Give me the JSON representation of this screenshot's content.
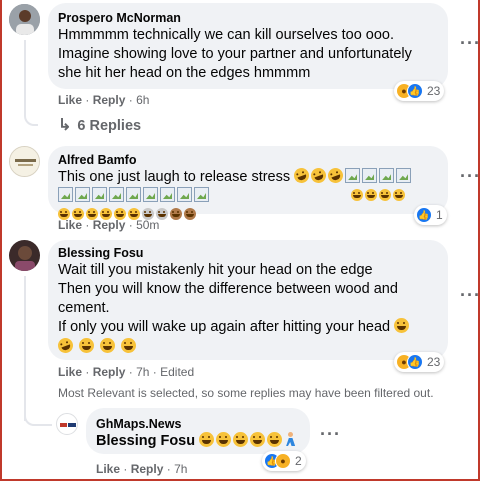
{
  "comments": [
    {
      "author": "Prospero McNorman",
      "lines": [
        "Hmmmmm technically we can kill ourselves too ooo.",
        "Imagine showing love to your partner and unfortunately",
        "she hit her head on the edges hmmmm"
      ],
      "like_label": "Like",
      "reply_label": "Reply",
      "time": "6h",
      "reaction_count": "23",
      "replies_label": "6 Replies"
    },
    {
      "author": "Alfred Bamfo",
      "line1": "This one just laugh to release stress",
      "like_label": "Like",
      "reply_label": "Reply",
      "time": "50m",
      "reaction_count": "1"
    },
    {
      "author": "Blessing Fosu",
      "lines": [
        "Wait till you mistakenly hit your head on the edge",
        "Then you will know the difference between wood and",
        "cement.",
        "If only you will wake up again after hitting your head"
      ],
      "like_label": "Like",
      "reply_label": "Reply",
      "time": "7h",
      "edited_label": "Edited",
      "reaction_count": "23"
    }
  ],
  "filter_notice": "Most Relevant is selected, so some replies may have been filtered out.",
  "reply": {
    "author": "GhMaps.News",
    "text": "Blessing Fosu",
    "like_label": "Like",
    "reply_label": "Reply",
    "time": "7h",
    "reaction_count": "2"
  },
  "separator": "·",
  "colors": {
    "bubble": "#f0f2f5",
    "secondary_text": "#65676b",
    "like_blue": "#1877f2",
    "haha_yellow": "#f7b125",
    "frame_red": "#c0392b"
  },
  "icons": [
    "more-options-icon",
    "reply-arrow-icon",
    "like-reaction-icon",
    "haha-reaction-icon",
    "laughing-emoji-icon"
  ]
}
